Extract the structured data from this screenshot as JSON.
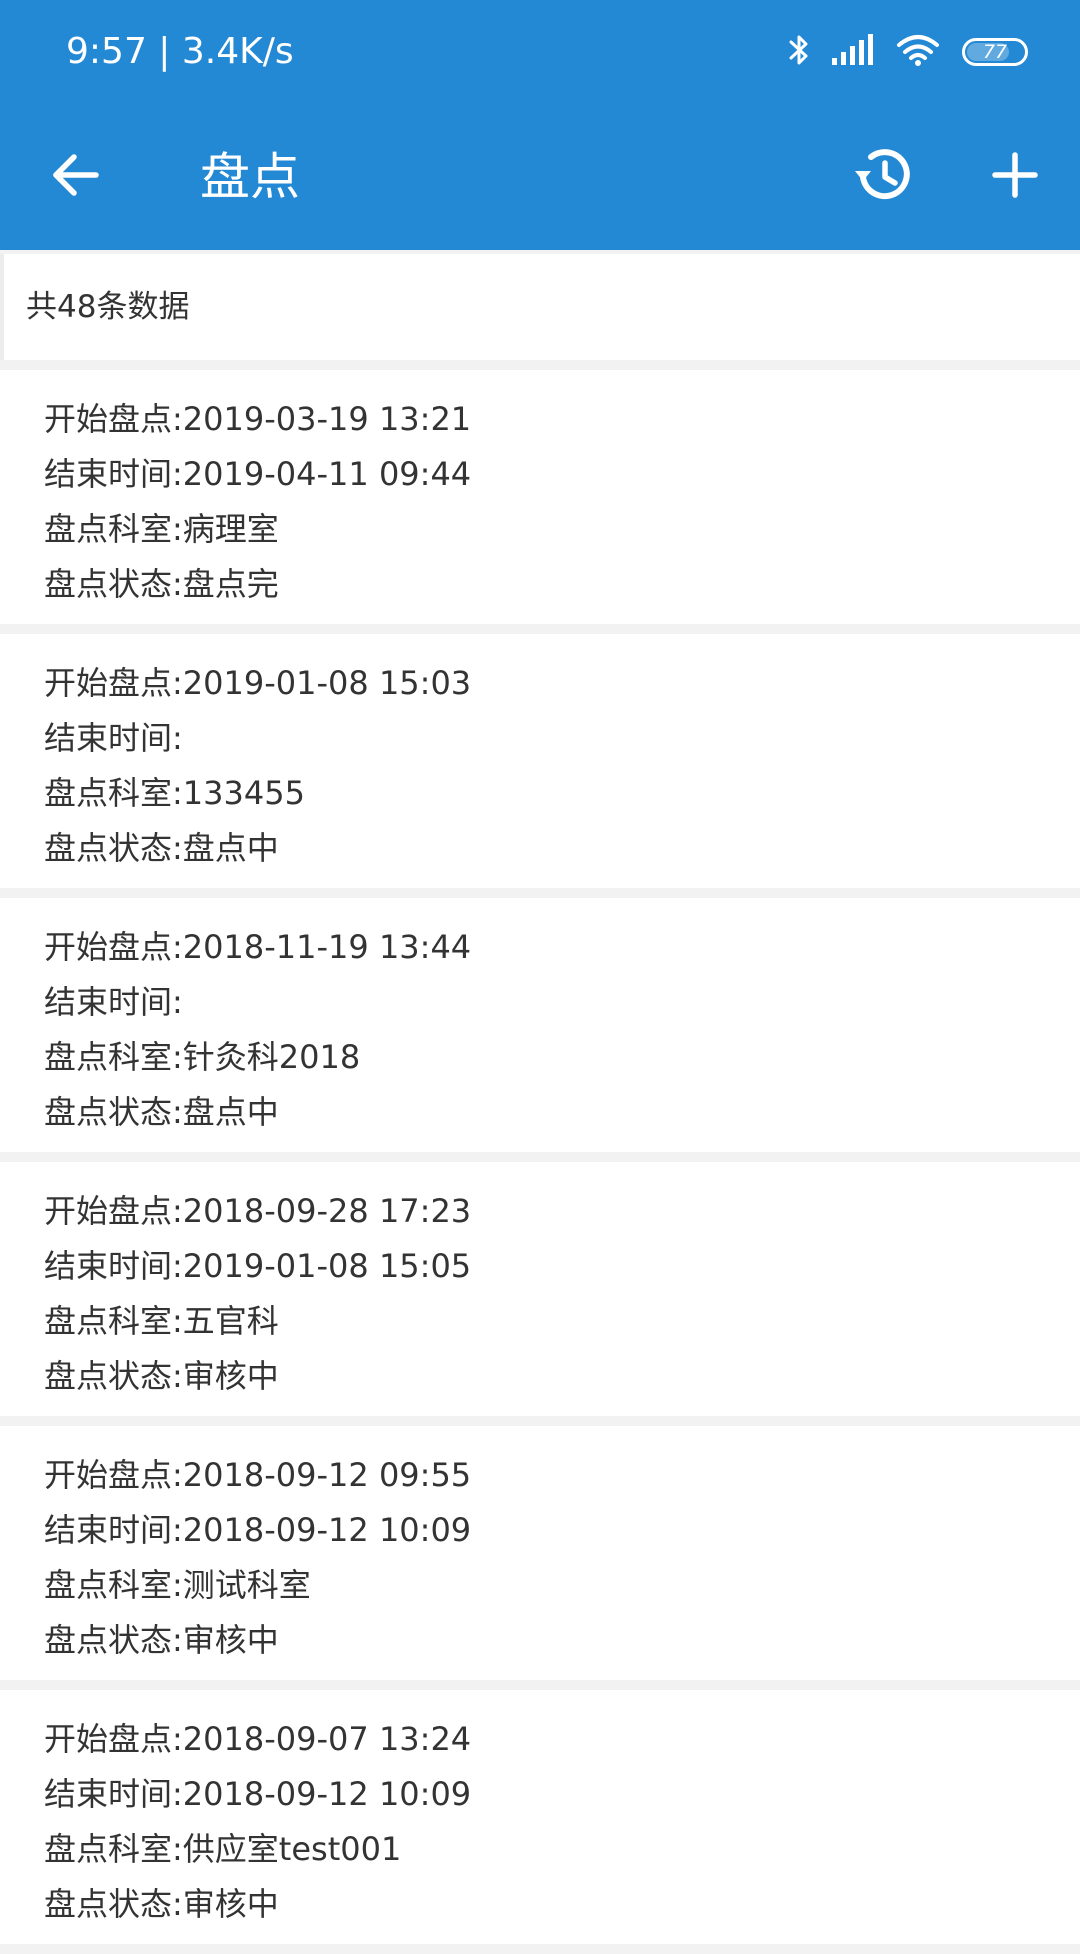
{
  "status_bar": {
    "time": "9:57",
    "separator": "|",
    "speed": "3.4K/s",
    "battery": "77",
    "battery_level_percent": 77,
    "icons": [
      "bluetooth-icon",
      "signal-icon",
      "wifi-icon",
      "battery-icon"
    ]
  },
  "toolbar": {
    "title": "盘点",
    "back_icon": "arrow-left-icon",
    "history_icon": "history-icon",
    "add_icon": "plus-icon"
  },
  "summary": {
    "text": "共48条数据"
  },
  "labels": {
    "start": "开始盘点:",
    "end": "结束时间:",
    "dept": "盘点科室:",
    "status": "盘点状态:"
  },
  "records": [
    {
      "start": "2019-03-19 13:21",
      "end": "2019-04-11 09:44",
      "dept": "病理室",
      "status": "盘点完"
    },
    {
      "start": "2019-01-08 15:03",
      "end": "",
      "dept": "133455",
      "status": "盘点中"
    },
    {
      "start": "2018-11-19 13:44",
      "end": "",
      "dept": "针灸科2018",
      "status": "盘点中"
    },
    {
      "start": "2018-09-28 17:23",
      "end": "2019-01-08 15:05",
      "dept": "五官科",
      "status": "审核中"
    },
    {
      "start": "2018-09-12 09:55",
      "end": "2018-09-12 10:09",
      "dept": "测试科室",
      "status": "审核中"
    },
    {
      "start": "2018-09-07 13:24",
      "end": "2018-09-12 10:09",
      "dept": "供应室test001",
      "status": "审核中"
    }
  ],
  "colors": {
    "primary": "#2489d4",
    "background": "#f2f2f2",
    "card": "#ffffff",
    "text": "#333333"
  }
}
